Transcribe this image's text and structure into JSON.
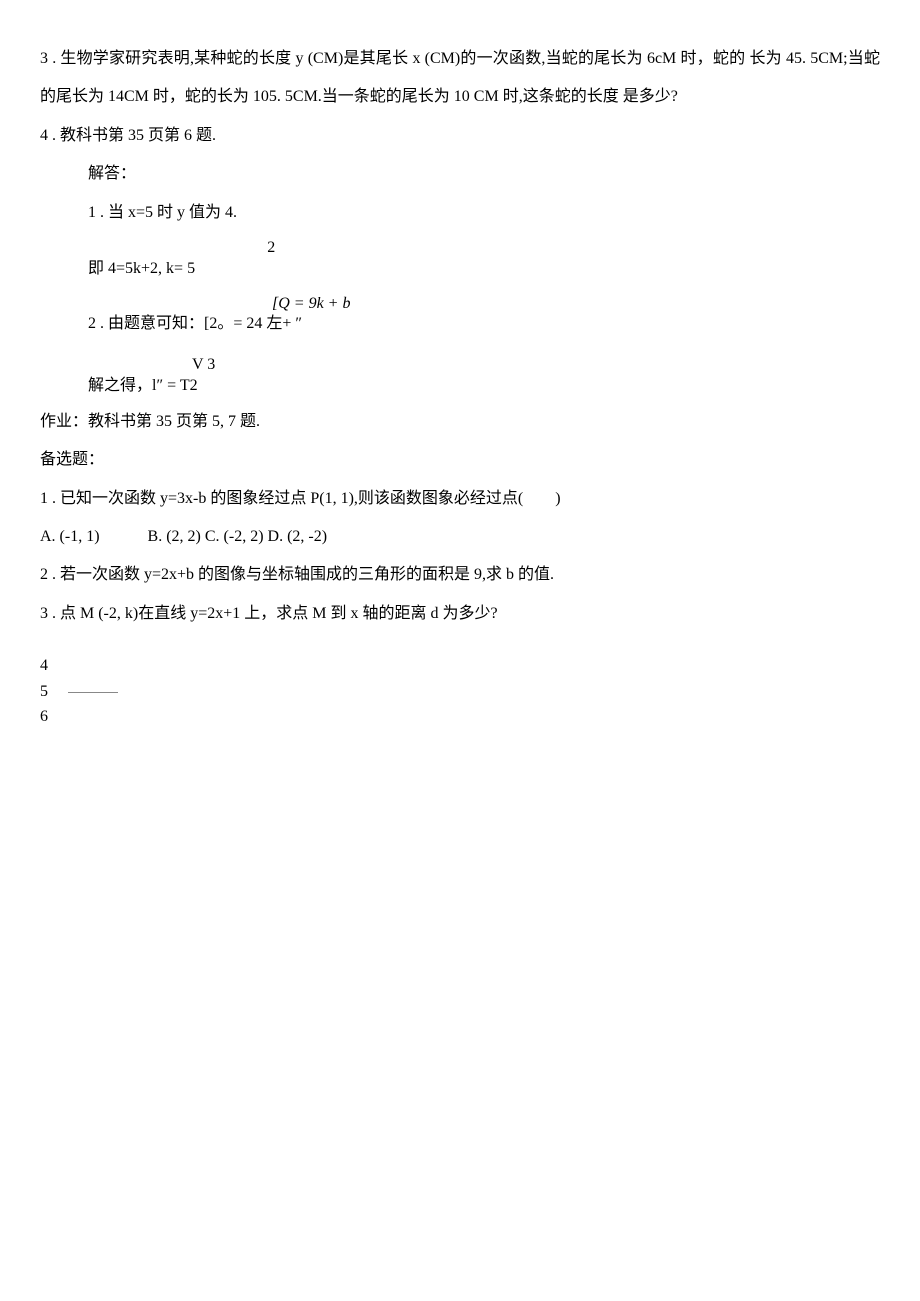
{
  "p1": "3 . 生物学家研究表明,某种蛇的长度 y (CM)是其尾长 x (CM)的一次函数,当蛇的尾长为 6cM 时，蛇的 长为 45. 5CM;当蛇的尾长为 14CM 时，蛇的长为 105. 5CM.当一条蛇的尾长为 10 CM 时,这条蛇的长度 是多少?",
  "p2": "4 . 教科书第 35 页第 6 题.",
  "p3": "解答：",
  "p4": "1 . 当 x=5 时 y 值为 4.",
  "p5_upper": "2",
  "p5_line": "即 4=5k+2, k= 5",
  "p6_upper": "",
  "p6_eq1": "[Q = 9k + b",
  "p6_line": "2 . 由题意可知：[2。= 24 左+ ″",
  "p7_upper": "V 3",
  "p7_line": "解之得，l″ = T2",
  "p8": "作业：教科书第 35 页第 5, 7 题.",
  "p9": "备选题：",
  "p10": "1 . 已知一次函数 y=3x-b 的图象经过点 P(1, 1),则该函数图象必经过点(　　)",
  "p11": "A. (-1, 1)　　　B. (2, 2) C. (-2, 2) D. (2, -2)",
  "p12": "2 . 若一次函数 y=2x+b 的图像与坐标轴围成的三角形的面积是 9,求 b 的值.",
  "p13": "3 . 点 M (-2, k)在直线 y=2x+1 上，求点 M 到 x 轴的距离 d 为多少?",
  "n4": "4",
  "n5": "5",
  "n6": "6"
}
